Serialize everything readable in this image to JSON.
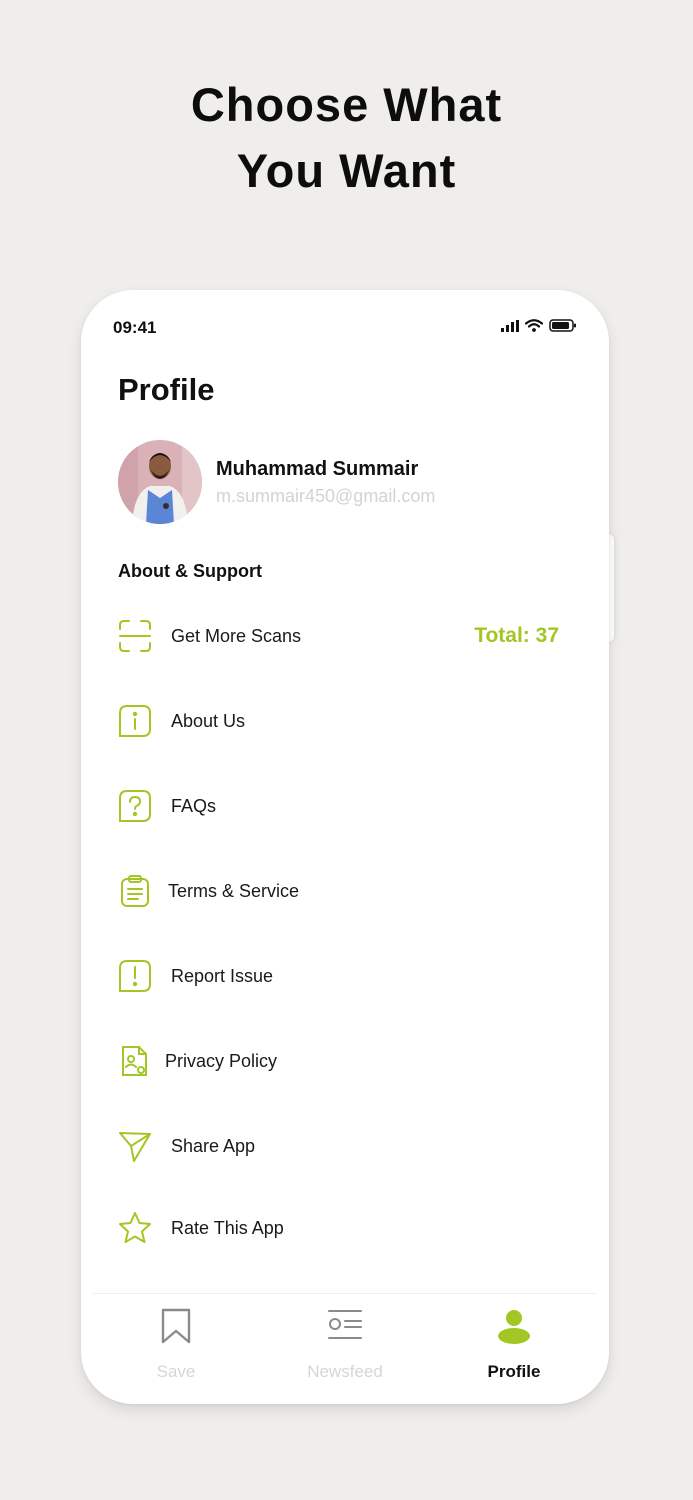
{
  "headline": {
    "line1": "Choose What",
    "line2": "You Want"
  },
  "status_bar": {
    "time": "09:41"
  },
  "profile": {
    "title": "Profile",
    "name": "Muhammad Summair",
    "email": "m.summair450@gmail.com"
  },
  "section": {
    "title": "About & Support"
  },
  "menu": {
    "items": [
      {
        "label": "Get More Scans",
        "icon": "scan-icon"
      },
      {
        "label": "About Us",
        "icon": "info-icon"
      },
      {
        "label": "FAQs",
        "icon": "question-icon"
      },
      {
        "label": "Terms & Service",
        "icon": "clipboard-icon"
      },
      {
        "label": "Report Issue",
        "icon": "alert-icon"
      },
      {
        "label": "Privacy Policy",
        "icon": "document-user-icon"
      },
      {
        "label": "Share App",
        "icon": "send-icon"
      },
      {
        "label": "Rate This App",
        "icon": "star-icon"
      }
    ],
    "scan_total": "Total: 37"
  },
  "bottom_nav": {
    "items": [
      {
        "label": "Save",
        "icon": "bookmark-icon"
      },
      {
        "label": "Newsfeed",
        "icon": "newsfeed-icon"
      },
      {
        "label": "Profile",
        "icon": "user-icon",
        "active": true
      }
    ]
  },
  "colors": {
    "accent": "#a2c724",
    "background": "#f0eeeb",
    "inactive": "#d6d6d6"
  }
}
